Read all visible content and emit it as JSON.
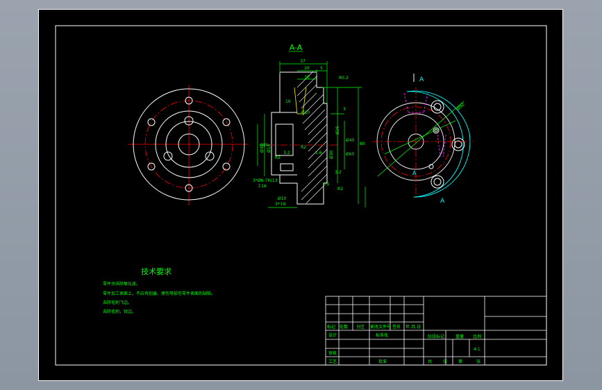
{
  "section_label": "A-A",
  "view_marks": {
    "cut_top": "A",
    "cut_bottom": "A",
    "view_arrow": "A"
  },
  "dimensions": {
    "total_width": "37",
    "d20": "20",
    "d5": "5",
    "d10": "10",
    "d16": "16",
    "r_tip": "R0.2",
    "d3": "3",
    "dia_x": "Ø10",
    "d80": "80",
    "dia_a": "Ø40",
    "dia_b": "Ø60",
    "dia_c": "Ø80",
    "r2_left": "R2",
    "r2_mid": "R2",
    "r2_right": "R2",
    "chamfer": "C1",
    "hole_note_1": "3*Ø6-7H/13",
    "hole_note_2": "↧16",
    "small_note_1": "Ø10",
    "small_note_2": "3*↧6",
    "dia_left_1": "Ø40",
    "dia_left_2": "Ø14",
    "dia_mid_1": "Ø30",
    "dia_mid_2": "Ø26",
    "right_view_dia": "Ø92",
    "rough_1": "3.2",
    "rough_2": "1.6",
    "rough_3": "3.2"
  },
  "tech_requirements": {
    "title": "技术要求",
    "lines": [
      "零件须去除氧化皮。",
      "零件加工表面上，不应有划痕、擦伤等损伤零件表面的缺陷。",
      "去除毛刺飞边。",
      "去除毛刺，锐边。"
    ]
  },
  "title_block": {
    "row_headers": [
      "标记",
      "处数",
      "分区",
      "更改文件号",
      "签名",
      "年.月.日"
    ],
    "design": "设计",
    "standardize": "标准化",
    "stage_mark": "阶段标记",
    "weight": "重量",
    "scale": "比例",
    "scale_value": "4:1",
    "review": "审核",
    "process": "工艺",
    "approve": "批准",
    "sheets_total": "共",
    "sheets_label": "张",
    "sheet_no": "第",
    "sheet_label": "张"
  },
  "colors": {
    "background": "#000000",
    "outline": "#ffffff",
    "dimension": "#00ff00",
    "centerline": "#ff0000",
    "hidden": "#ff00ff",
    "cutline": "#00ffff"
  }
}
